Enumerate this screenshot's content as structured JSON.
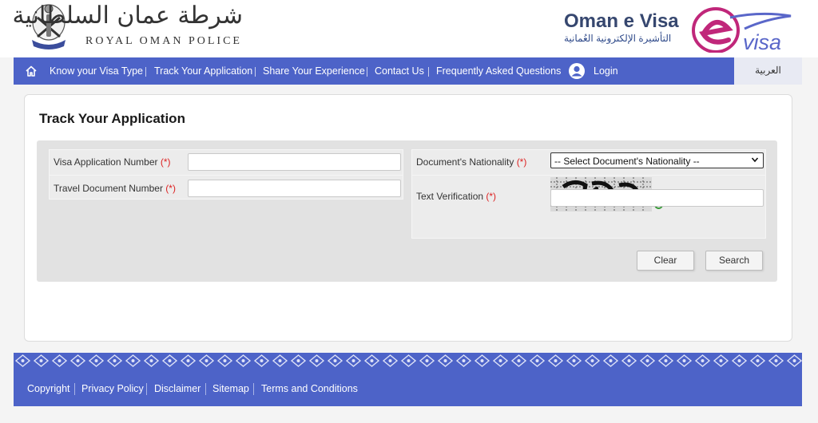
{
  "header": {
    "police_name_arabic": "شرطة عمان السلطانية",
    "police_name_english": "ROYAL OMAN POLICE",
    "site_title": "Oman e Visa",
    "site_title_arabic": "التأشيرة الإلكترونية العُمانية",
    "logo_icon": "evisa-logo",
    "logo_text": "visa"
  },
  "nav": {
    "home_icon": "home-icon",
    "items": [
      "Know your Visa Type",
      "Track Your Application",
      "Share Your Experience",
      "Contact Us",
      "Frequently Asked Questions"
    ],
    "login_label": "Login",
    "language_label": "العربية"
  },
  "page": {
    "title": "Track Your Application"
  },
  "form": {
    "visa_number_label": "Visa Application Number",
    "travel_document_label": "Travel Document Number",
    "nationality_label": "Document's Nationality",
    "nationality_selected": "-- Select Document's Nationality --",
    "verification_label": "Text Verification",
    "required_mark": "(*)",
    "visa_number_value": "",
    "travel_document_value": "",
    "verification_value": ""
  },
  "buttons": {
    "clear_label": "Clear",
    "search_label": "Search"
  },
  "footer": {
    "links": [
      "Copyright",
      "Privacy Policy",
      "Disclaimer",
      "Sitemap",
      "Terms and Conditions"
    ]
  },
  "colors": {
    "brand_blue": "#4d63c8",
    "required_red": "#dd2222",
    "evisa_magenta": "#c0277a"
  }
}
